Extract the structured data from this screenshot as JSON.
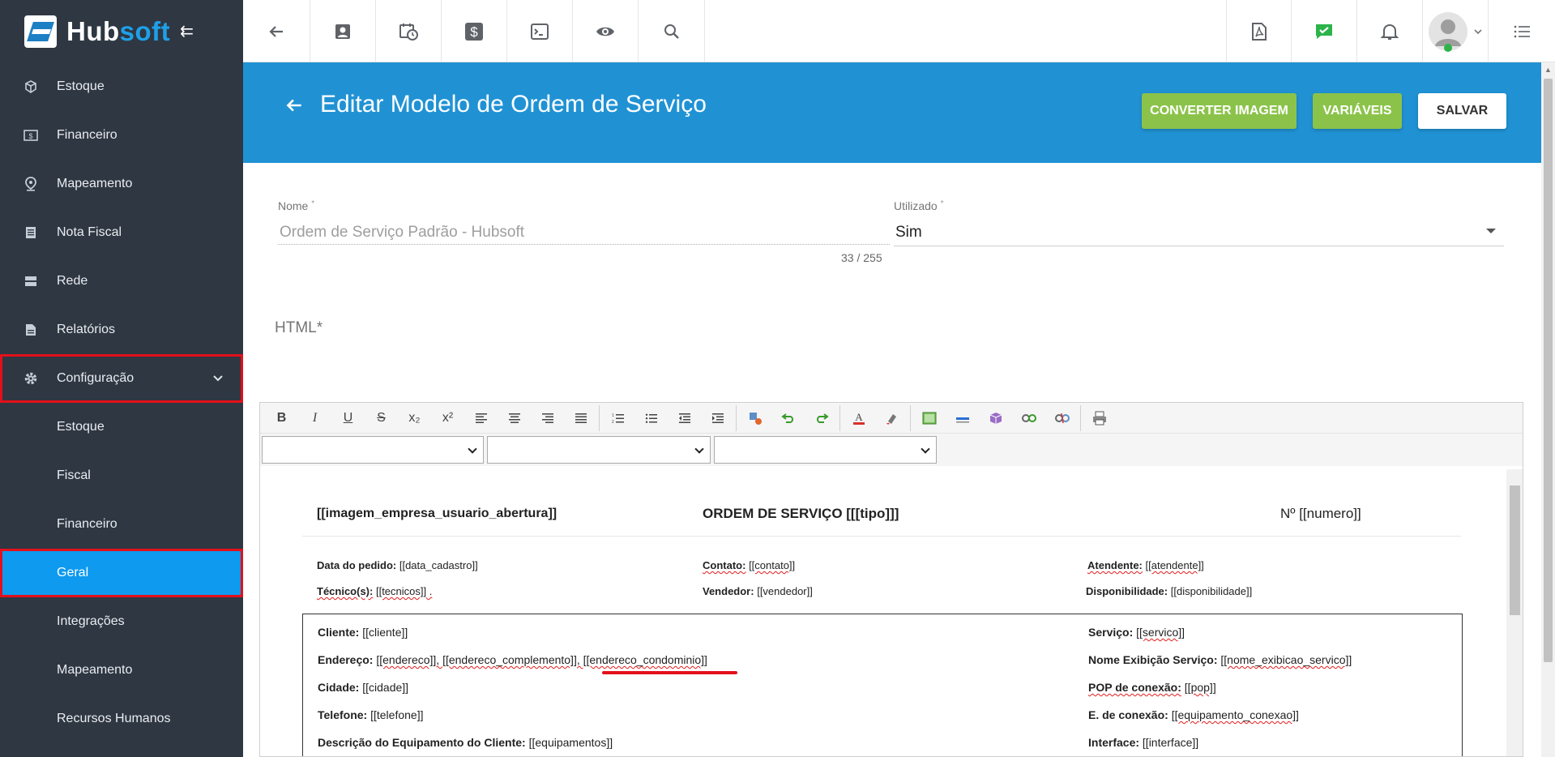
{
  "brand": {
    "name_part1": "Hub",
    "name_part2": "soft"
  },
  "sidebar": {
    "items": [
      {
        "label": "Estoque",
        "icon": "box-icon"
      },
      {
        "label": "Financeiro",
        "icon": "money-icon"
      },
      {
        "label": "Mapeamento",
        "icon": "map-pin-icon"
      },
      {
        "label": "Nota Fiscal",
        "icon": "document-icon"
      },
      {
        "label": "Rede",
        "icon": "server-icon"
      },
      {
        "label": "Relatórios",
        "icon": "report-icon"
      }
    ],
    "config": {
      "label": "Configuração",
      "icon": "gear-icon"
    },
    "sub_items": [
      {
        "label": "Estoque"
      },
      {
        "label": "Fiscal"
      },
      {
        "label": "Financeiro"
      },
      {
        "label": "Geral"
      },
      {
        "label": "Integrações"
      },
      {
        "label": "Mapeamento"
      },
      {
        "label": "Recursos Humanos"
      }
    ]
  },
  "topbar": {
    "icons": [
      "back-arrow-icon",
      "contact-icon",
      "calendar-clock-icon",
      "dollar-icon",
      "terminal-icon",
      "eye-icon",
      "search-icon",
      "pdf-icon",
      "chat-check-icon",
      "bell-icon",
      "avatar",
      "list-icon"
    ]
  },
  "header": {
    "title": "Editar Modelo de Ordem de Serviço",
    "buttons": {
      "convert": "CONVERTER IMAGEM",
      "variables": "VARIÁVEIS",
      "save": "SALVAR"
    }
  },
  "form": {
    "name_label": "Nome",
    "name_value": "Ordem de Serviço Padrão - Hubsoft",
    "name_counter": "33 / 255",
    "used_label": "Utilizado",
    "used_value": "Sim",
    "html_label": "HTML*",
    "required_mark": "*"
  },
  "editor": {
    "toolbar": [
      "B",
      "I",
      "U",
      "S",
      "x₂",
      "x²"
    ],
    "doc": {
      "logo_var": "[[imagem_empresa_usuario_abertura]]",
      "title": "ORDEM DE SERVIÇO [[[tipo]]]",
      "number": "Nº [[numero]]",
      "row1": [
        {
          "label": "Data do pedido:",
          "value": "[[data_cadastro]]"
        },
        {
          "label": "Contato:",
          "value": "[[contato]]"
        },
        {
          "label": "Atendente:",
          "value": "[[atendente]]"
        }
      ],
      "row2": [
        {
          "label": "Técnico(s):",
          "value": "[[tecnicos]] ."
        },
        {
          "label": "Vendedor:",
          "value": "[[vendedor]]"
        },
        {
          "label": "Disponibilidade:",
          "value": "[[disponibilidade]]"
        }
      ],
      "left_fields": [
        {
          "label": "Cliente:",
          "value": "[[cliente]]"
        },
        {
          "label": "Endereço:",
          "value": "[[endereco]], [[endereco_complemento]], [[endereco_condominio]]"
        },
        {
          "label": "Cidade:",
          "value": "[[cidade]]"
        },
        {
          "label": "Telefone:",
          "value": "[[telefone]]"
        },
        {
          "label": "Descrição do Equipamento do Cliente:",
          "value": "[[equipamentos]]"
        }
      ],
      "right_fields": [
        {
          "label": "Serviço:",
          "value": "[[servico]]"
        },
        {
          "label": "Nome Exibição Serviço:",
          "value": "[[nome_exibicao_servico]]"
        },
        {
          "label": "POP de conexão:",
          "value": "[[pop]]"
        },
        {
          "label": "E. de conexão:",
          "value": "[[equipamento_conexao]]"
        },
        {
          "label": "Interface:",
          "value": "[[interface]]"
        }
      ]
    }
  },
  "colors": {
    "sidebar": "#2f3742",
    "accent": "#0d9aef",
    "header": "#2092d4",
    "green": "#8bc34a",
    "highlight": "#e3101b"
  }
}
